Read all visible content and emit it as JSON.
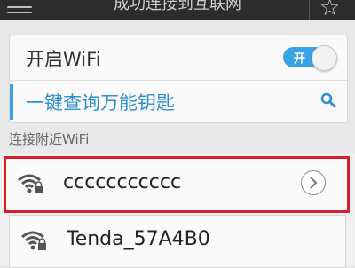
{
  "topbar": {
    "title": "成功连接到互联网",
    "menu_icon": "menu-icon",
    "star_icon": "star-icon"
  },
  "settings": {
    "wifi_toggle_label": "开启WiFi",
    "switch_on_label": "开",
    "switch_state": "on",
    "query_label": "一键查询万能钥匙",
    "query_icon": "search-icon"
  },
  "nearby": {
    "section_title": "连接附近WiFi",
    "networks": [
      {
        "name": "ccccccccccc",
        "selected": true,
        "locked": true
      },
      {
        "name": "Tenda_57A4B0",
        "selected": false,
        "locked": true
      }
    ]
  },
  "colors": {
    "accent": "#3aa3e3",
    "selection": "#d81e29",
    "topbar": "#2c2c2c"
  }
}
